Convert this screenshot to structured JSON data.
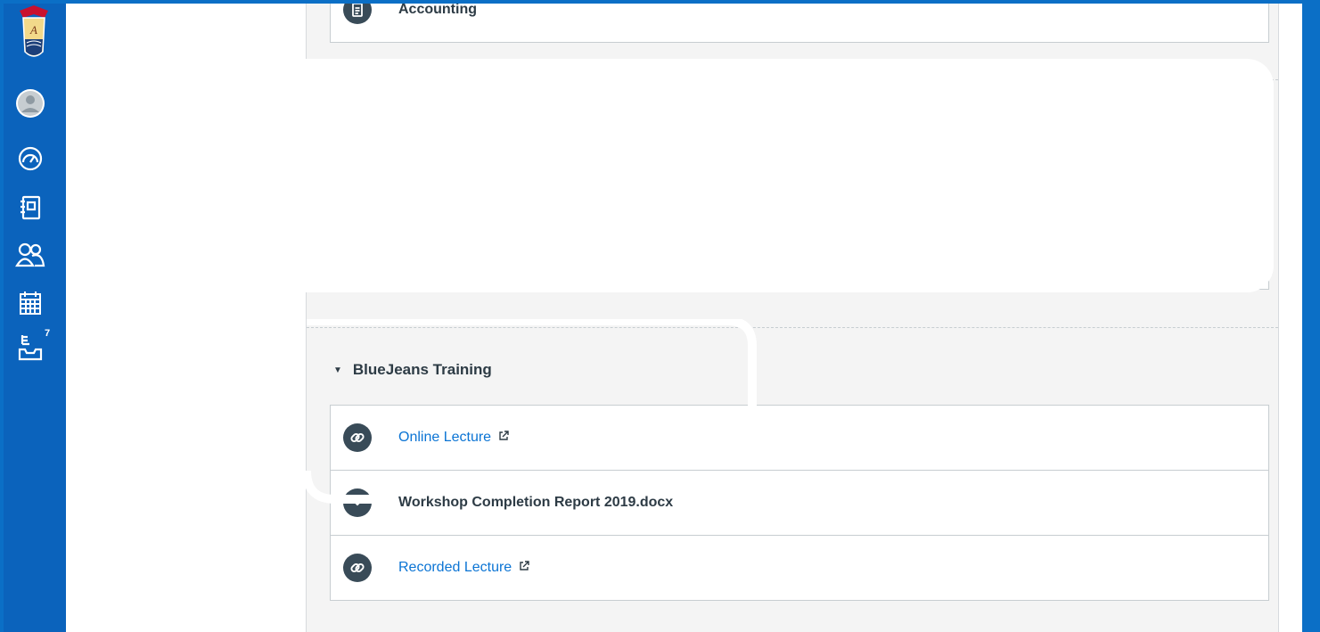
{
  "global_nav": {
    "items": [
      {
        "name": "account",
        "icon": "account-icon"
      },
      {
        "name": "dashboard",
        "icon": "dashboard-icon"
      },
      {
        "name": "courses",
        "icon": "courses-icon"
      },
      {
        "name": "groups",
        "icon": "groups-icon"
      },
      {
        "name": "calendar",
        "icon": "calendar-icon"
      },
      {
        "name": "inbox",
        "icon": "inbox-icon",
        "badge": "7"
      }
    ],
    "brand_color": "#0b63bc"
  },
  "top_module": {
    "items": [
      {
        "title": "Accounting",
        "icon": "document-icon"
      }
    ]
  },
  "bluejeans_module": {
    "title": "BlueJeans Training",
    "items": [
      {
        "title": "Online Lecture",
        "icon": "link-icon",
        "external": true
      },
      {
        "title": "Workshop Completion Report 2019.docx",
        "icon": "attachment-icon",
        "external": false
      },
      {
        "title": "Recorded Lecture",
        "icon": "link-icon",
        "external": true
      }
    ]
  },
  "colors": {
    "link": "#0b74d4",
    "icon_bg": "#394b58",
    "frame": "#0b6fc6"
  }
}
